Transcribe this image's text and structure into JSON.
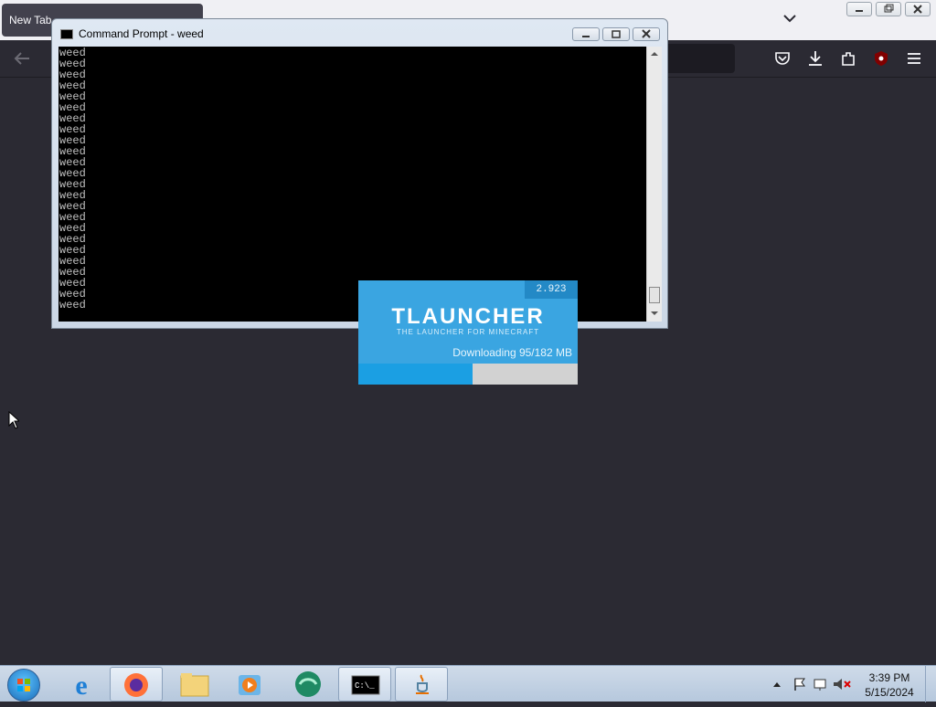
{
  "browser": {
    "tab_title": "New Tab"
  },
  "cmd": {
    "title": "Command Prompt - weed",
    "line_text": "weed",
    "line_count": 24
  },
  "tlauncher": {
    "version": "2.923",
    "title": "TLAUNCHER",
    "subtitle": "THE LAUNCHER FOR MINECRAFT",
    "status": "Downloading 95/182 MB",
    "progress_fraction": 0.522
  },
  "taskbar": {
    "time": "3:39 PM",
    "date": "5/15/2024"
  }
}
